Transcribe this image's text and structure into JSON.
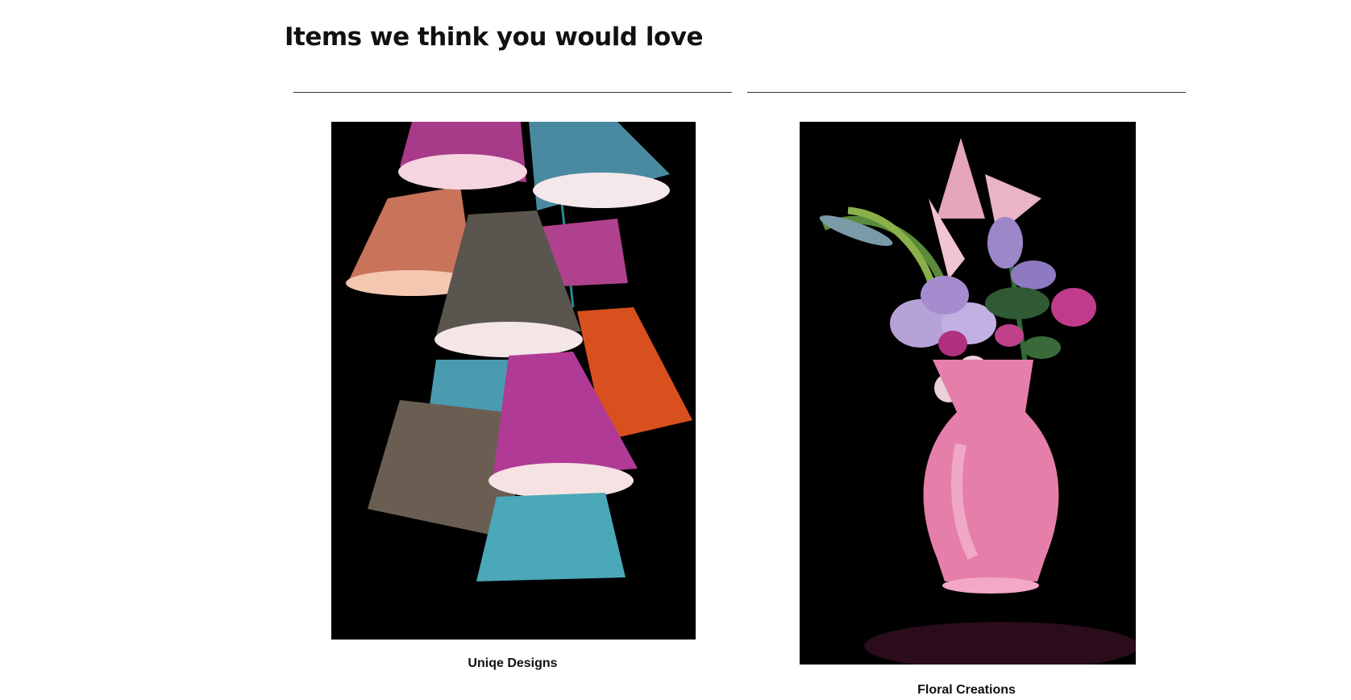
{
  "section": {
    "title": "Items we think you would love"
  },
  "products": [
    {
      "caption": "Uniqe Designs",
      "image_subject": "colorful-lampshades"
    },
    {
      "caption": "Floral Creations",
      "image_subject": "flowers-in-pink-vase"
    }
  ],
  "colors": {
    "background": "#ffffff",
    "text": "#111111",
    "rule": "#333333",
    "image_background": "#000000"
  }
}
